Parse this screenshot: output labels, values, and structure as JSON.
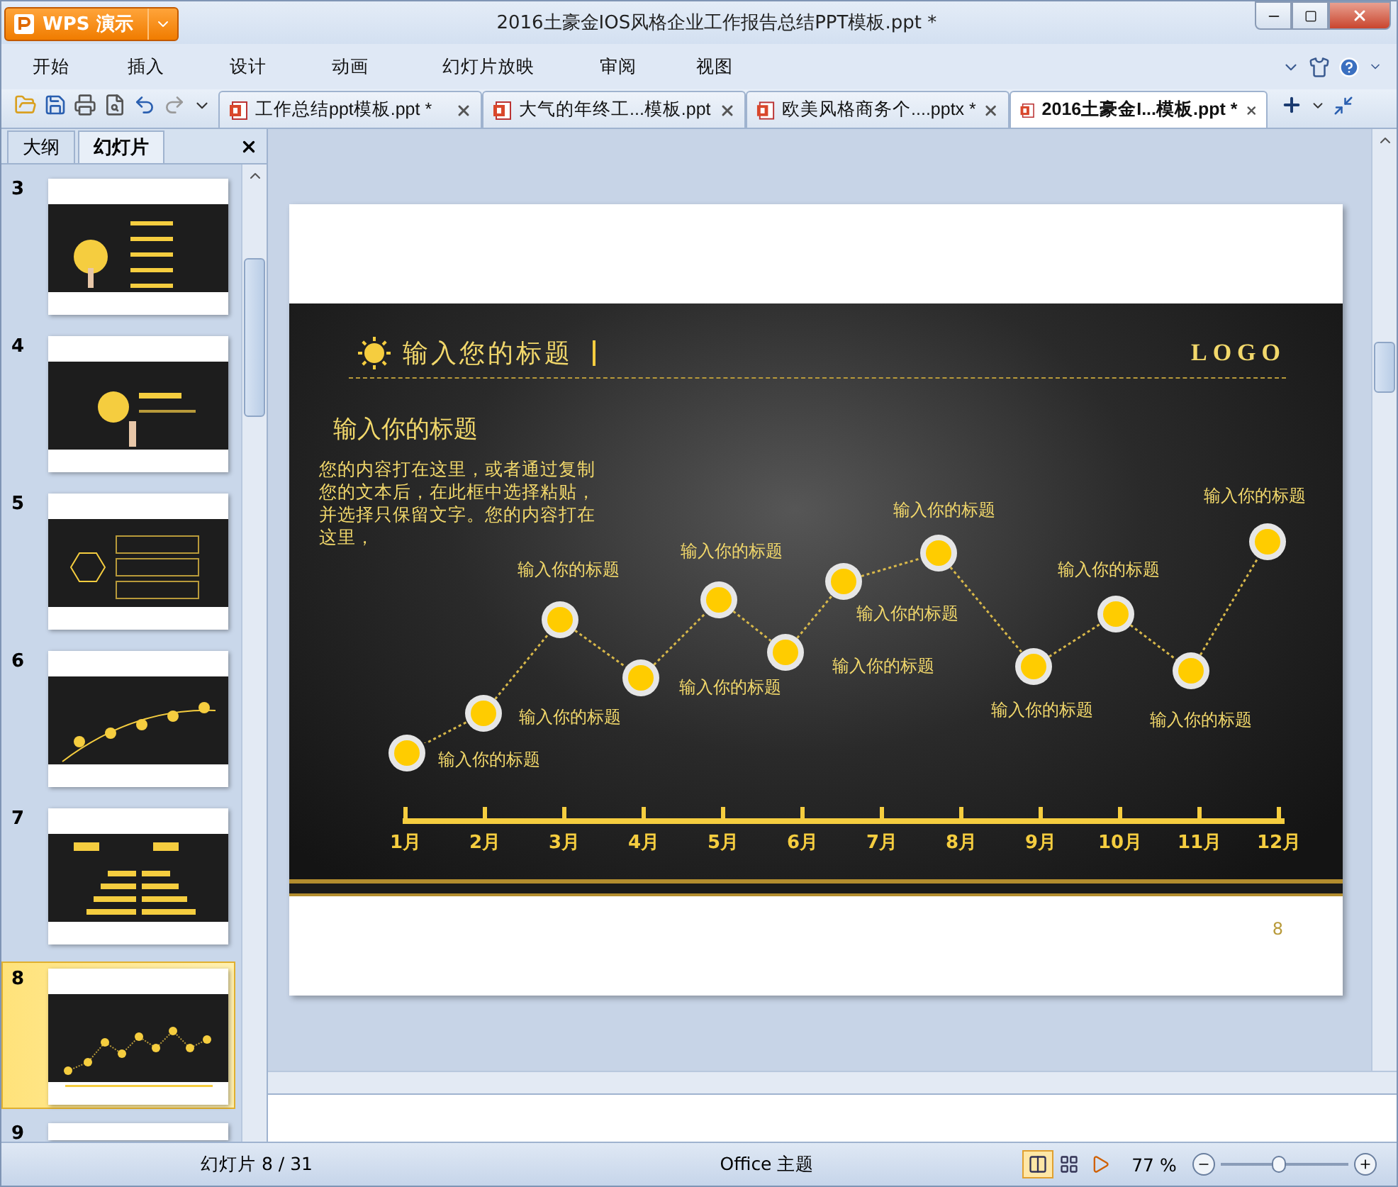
{
  "app": {
    "name": "WPS 演示"
  },
  "window": {
    "title": "2016土豪金IOS风格企业工作报告总结PPT模板.ppt *"
  },
  "menu": [
    "开始",
    "插入",
    "设计",
    "动画",
    "幻灯片放映",
    "审阅",
    "视图"
  ],
  "doc_tabs": [
    {
      "label": "工作总结ppt模板.ppt *",
      "selected": false
    },
    {
      "label": "大气的年终工...模板.ppt",
      "selected": false
    },
    {
      "label": "欧美风格商务个....pptx *",
      "selected": false
    },
    {
      "label": "2016土豪金I...模板.ppt *",
      "selected": true
    }
  ],
  "panel_tabs": [
    {
      "label": "大纲",
      "selected": false
    },
    {
      "label": "幻灯片",
      "selected": true
    }
  ],
  "thumbnails": [
    {
      "number": "3",
      "kind": "agenda",
      "selected": false
    },
    {
      "number": "4",
      "kind": "section",
      "selected": false
    },
    {
      "number": "5",
      "kind": "boxes",
      "selected": false
    },
    {
      "number": "6",
      "kind": "curve",
      "selected": false
    },
    {
      "number": "7",
      "kind": "bars",
      "selected": false
    },
    {
      "number": "8",
      "kind": "timeline",
      "selected": true
    },
    {
      "number": "9",
      "kind": "cut",
      "selected": false
    }
  ],
  "slide": {
    "heading": "输入您的标题",
    "logo": "LOGO",
    "subtitle": "输入你的标题",
    "body": "您的内容打在这里，或者通过复制您的文本后，在此框中选择粘贴，并选择只保留文字。您的内容打在这里，",
    "points": [
      "输入你的标题",
      "输入你的标题",
      "输入你的标题",
      "输入你的标题",
      "输入你的标题",
      "输入你的标题",
      "输入你的标题",
      "输入你的标题",
      "输入你的标题",
      "输入你的标题",
      "输入你的标题",
      "输入你的标题"
    ],
    "months": [
      "1月",
      "2月",
      "3月",
      "4月",
      "5月",
      "6月",
      "7月",
      "8月",
      "9月",
      "10月",
      "11月",
      "12月"
    ],
    "page_number": "8"
  },
  "status_bar": {
    "slide_count": "幻灯片 8 / 31",
    "theme": "Office 主题",
    "views": [
      {
        "kind": "normal",
        "selected": true
      },
      {
        "kind": "sorter",
        "selected": false
      },
      {
        "kind": "show",
        "selected": false
      }
    ],
    "zoom": "77 %",
    "zoom_slider": {
      "level": 0.45
    }
  }
}
